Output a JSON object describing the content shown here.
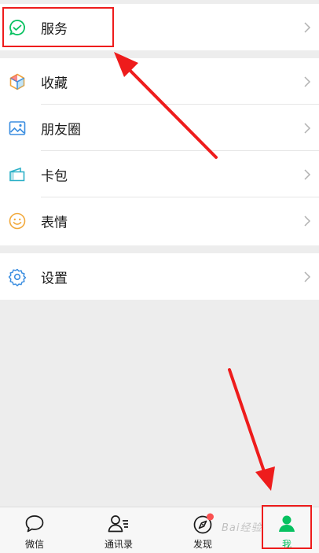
{
  "menu": {
    "service": {
      "label": "服务",
      "icon": "service-check-icon"
    },
    "favorites": {
      "label": "收藏",
      "icon": "cube-icon"
    },
    "moments": {
      "label": "朋友圈",
      "icon": "picture-icon"
    },
    "cards": {
      "label": "卡包",
      "icon": "wallet-icon"
    },
    "stickers": {
      "label": "表情",
      "icon": "smiley-icon"
    },
    "settings": {
      "label": "设置",
      "icon": "gear-icon"
    }
  },
  "tabbar": {
    "tabs": [
      {
        "label": "微信",
        "icon": "chat-bubble-icon"
      },
      {
        "label": "通讯录",
        "icon": "contacts-icon"
      },
      {
        "label": "发现",
        "icon": "compass-icon"
      },
      {
        "label": "我",
        "icon": "person-icon"
      }
    ],
    "active_index": 3
  },
  "watermark": "Bai经验",
  "colors": {
    "accent": "#07c160",
    "annotation_red": "#ee1c1c",
    "badge_red": "#fa5151",
    "background": "#ededed"
  }
}
